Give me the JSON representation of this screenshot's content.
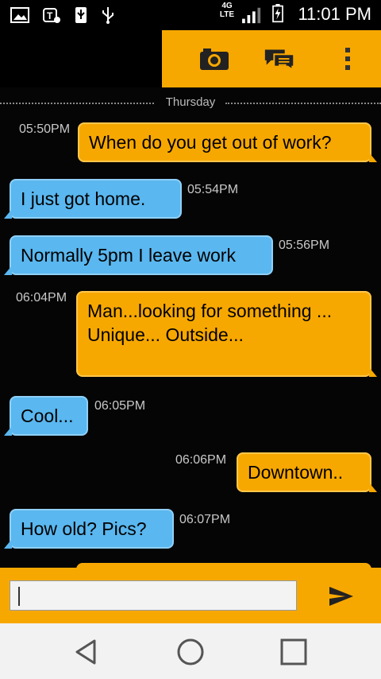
{
  "status_bar": {
    "time": "11:01 PM",
    "network": "4G LTE",
    "icons": [
      "gallery-icon",
      "tmobile-icon",
      "usb-debug-icon",
      "usb-icon",
      "signal-icon",
      "battery-charging-icon"
    ]
  },
  "header": {
    "icons": [
      "camera-icon",
      "chat-menu-icon",
      "overflow-menu-icon"
    ]
  },
  "chat": {
    "day_label": "Thursday",
    "messages": [
      {
        "direction": "out",
        "time": "05:50PM",
        "text": "When do you get out of work?"
      },
      {
        "direction": "in",
        "time": "05:54PM",
        "text": "I just got home."
      },
      {
        "direction": "in",
        "time": "05:56PM",
        "text": "Normally 5pm I leave work"
      },
      {
        "direction": "out",
        "time": "06:04PM",
        "text": "Man...looking for something ... Unique... Outside..."
      },
      {
        "direction": "in",
        "time": "06:05PM",
        "text": "Cool..."
      },
      {
        "direction": "out",
        "time": "06:06PM",
        "text": "Downtown.."
      },
      {
        "direction": "in",
        "time": "06:07PM",
        "text": "How old?  Pics?"
      }
    ]
  },
  "input": {
    "value": "",
    "placeholder": "",
    "send_icon": "send-icon"
  },
  "navbar": {
    "icons": [
      "back-icon",
      "home-icon",
      "recents-icon"
    ]
  },
  "colors": {
    "accent": "#f7a800",
    "incoming_bubble": "#5ab7ef",
    "background": "#000000"
  }
}
